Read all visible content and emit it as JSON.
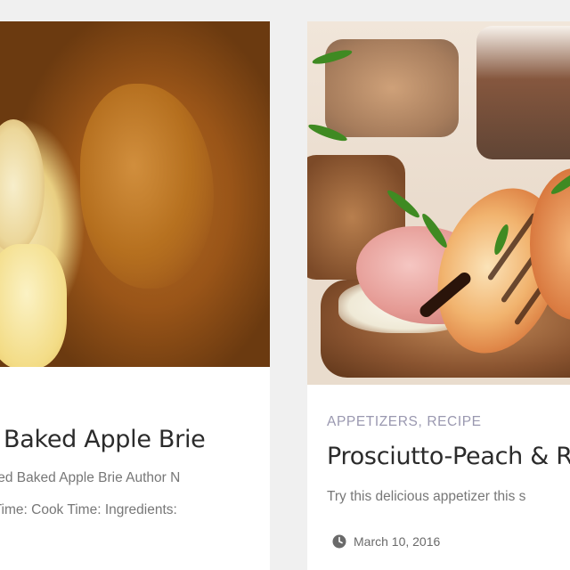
{
  "cards": [
    {
      "image_alt": "Baked apple brie in puff pastry",
      "title": "Baked Apple Brie",
      "excerpt_line1": "pped Baked Apple Brie Author N",
      "excerpt_line2": "p Time: Cook Time: Ingredients:"
    },
    {
      "image_alt": "Prosciutto and grilled peach on toast",
      "categories": [
        "APPETIZERS",
        "RECIPE"
      ],
      "category_separator": ",",
      "title": "Prosciutto-Peach & R",
      "excerpt_line1": "Try this delicious appetizer this s",
      "date": "March 10, 2016",
      "date_icon": "clock-icon"
    }
  ],
  "colors": {
    "page_background": "#f0f0f0",
    "card_background": "#ffffff",
    "title": "#2b2b2b",
    "excerpt": "#777777",
    "category": "#9a98b0",
    "meta": "#6a6a6a"
  }
}
